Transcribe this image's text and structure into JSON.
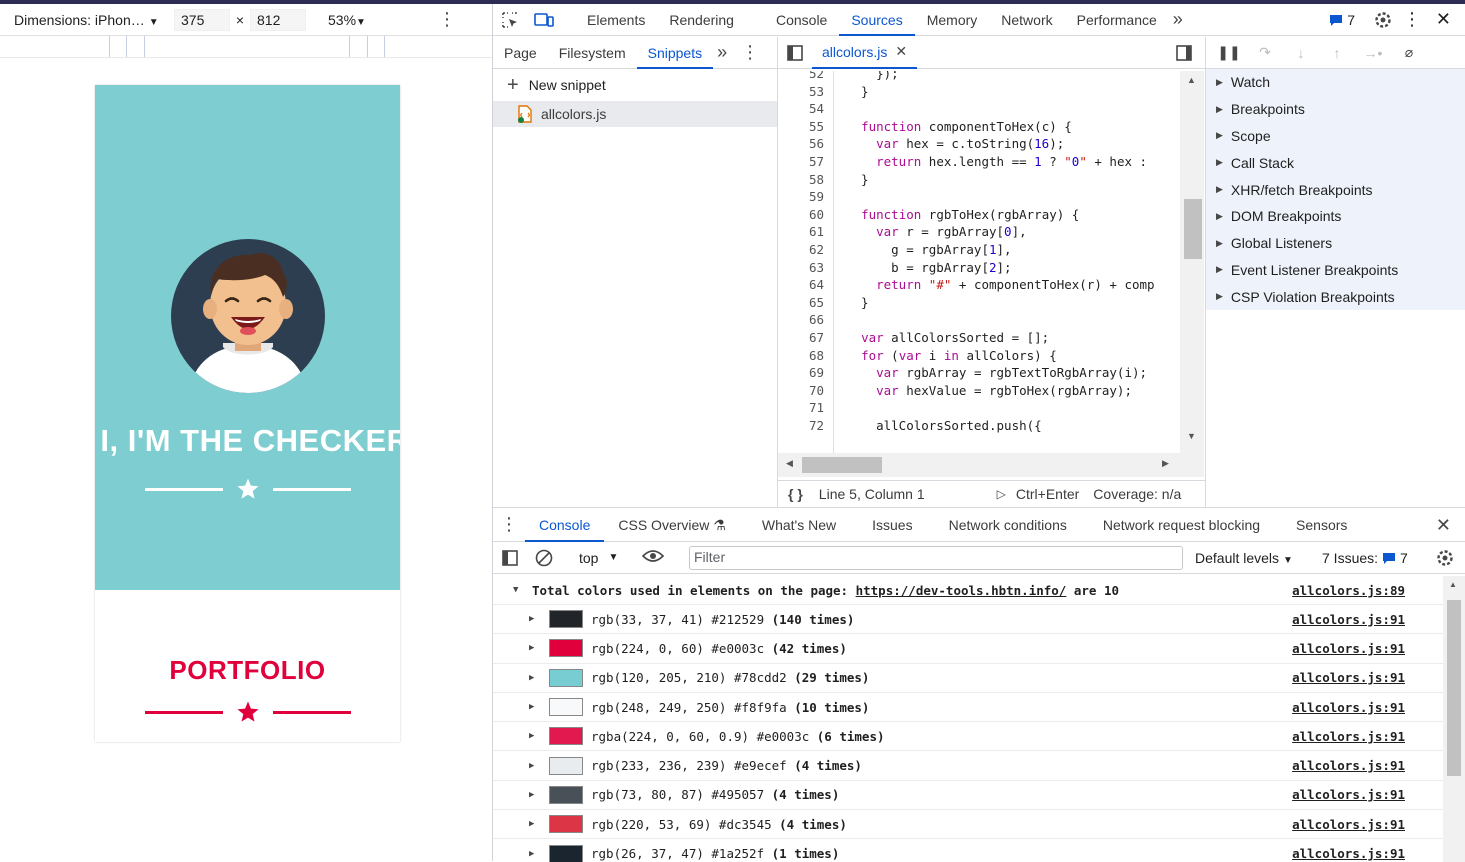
{
  "device_toolbar": {
    "dimensions_label": "Dimensions: iPhon…",
    "width_value": "375",
    "height_value": "812",
    "times": "×",
    "zoom": "53%"
  },
  "page": {
    "hero_title": "I, I'M THE CHECKER",
    "portfolio_title": "PORTFOLIO",
    "hero_color": "#7ecdd1",
    "accent_color": "#e0003c"
  },
  "main_tabs": [
    "Elements",
    "Rendering",
    "Console",
    "Sources",
    "Memory",
    "Network",
    "Performance"
  ],
  "issues_count": "7",
  "sources": {
    "sub_tabs": [
      "Page",
      "Filesystem",
      "Snippets"
    ],
    "new_snippet": "New snippet",
    "snippet_file": "allcolors.js",
    "editor_tab": "allcolors.js",
    "status_position": "Line 5, Column 1",
    "status_run": "Ctrl+Enter",
    "status_coverage": "Coverage: n/a"
  },
  "code_lines": [
    {
      "n": "52",
      "t": "    });"
    },
    {
      "n": "53",
      "t": "  }"
    },
    {
      "n": "54",
      "t": ""
    },
    {
      "n": "55",
      "t": "  function componentToHex(c) {"
    },
    {
      "n": "56",
      "t": "    var hex = c.toString(16);"
    },
    {
      "n": "57",
      "t": "    return hex.length == 1 ? \"0\" + hex :"
    },
    {
      "n": "58",
      "t": "  }"
    },
    {
      "n": "59",
      "t": ""
    },
    {
      "n": "60",
      "t": "  function rgbToHex(rgbArray) {"
    },
    {
      "n": "61",
      "t": "    var r = rgbArray[0],"
    },
    {
      "n": "62",
      "t": "      g = rgbArray[1],"
    },
    {
      "n": "63",
      "t": "      b = rgbArray[2];"
    },
    {
      "n": "64",
      "t": "    return \"#\" + componentToHex(r) + comp"
    },
    {
      "n": "65",
      "t": "  }"
    },
    {
      "n": "66",
      "t": ""
    },
    {
      "n": "67",
      "t": "  var allColorsSorted = [];"
    },
    {
      "n": "68",
      "t": "  for (var i in allColors) {"
    },
    {
      "n": "69",
      "t": "    var rgbArray = rgbTextToRgbArray(i);"
    },
    {
      "n": "70",
      "t": "    var hexValue = rgbToHex(rgbArray);"
    },
    {
      "n": "71",
      "t": ""
    },
    {
      "n": "72",
      "t": "    allColorsSorted.push({"
    }
  ],
  "debugger_sections": [
    "Watch",
    "Breakpoints",
    "Scope",
    "Call Stack",
    "XHR/fetch Breakpoints",
    "DOM Breakpoints",
    "Global Listeners",
    "Event Listener Breakpoints",
    "CSP Violation Breakpoints"
  ],
  "drawer_tabs": [
    "Console",
    "CSS Overview",
    "What's New",
    "Issues",
    "Network conditions",
    "Network request blocking",
    "Sensors"
  ],
  "console_toolbar": {
    "context": "top",
    "filter_placeholder": "Filter",
    "levels": "Default levels",
    "issues_label": "7 Issues:",
    "issues_count": "7"
  },
  "console_header": {
    "prefix": "Total colors used in elements on the page: ",
    "url": "https://dev-tools.hbtn.info/",
    "suffix": " are 10",
    "source": "allcolors.js:89"
  },
  "console_rows": [
    {
      "text": "rgb(33, 37, 41) #212529 ",
      "count": "(140 times)",
      "swatch": "#212529",
      "source": "allcolors.js:91"
    },
    {
      "text": "rgb(224, 0, 60) #e0003c ",
      "count": "(42 times)",
      "swatch": "#e0003c",
      "source": "allcolors.js:91"
    },
    {
      "text": "rgb(120, 205, 210) #78cdd2 ",
      "count": "(29 times)",
      "swatch": "#78cdd2",
      "source": "allcolors.js:91"
    },
    {
      "text": "rgb(248, 249, 250) #f8f9fa ",
      "count": "(10 times)",
      "swatch": "#f8f9fa",
      "source": "allcolors.js:91"
    },
    {
      "text": "rgba(224, 0, 60, 0.9) #e0003c ",
      "count": "(6 times)",
      "swatch": "#e2194f",
      "source": "allcolors.js:91"
    },
    {
      "text": "rgb(233, 236, 239) #e9ecef ",
      "count": "(4 times)",
      "swatch": "#e9ecef",
      "source": "allcolors.js:91"
    },
    {
      "text": "rgb(73, 80, 87) #495057 ",
      "count": "(4 times)",
      "swatch": "#495057",
      "source": "allcolors.js:91"
    },
    {
      "text": "rgb(220, 53, 69) #dc3545 ",
      "count": "(4 times)",
      "swatch": "#dc3545",
      "source": "allcolors.js:91"
    },
    {
      "text": "rgb(26, 37, 47) #1a252f ",
      "count": "(1 times)",
      "swatch": "#1a252f",
      "source": "allcolors.js:91"
    }
  ]
}
